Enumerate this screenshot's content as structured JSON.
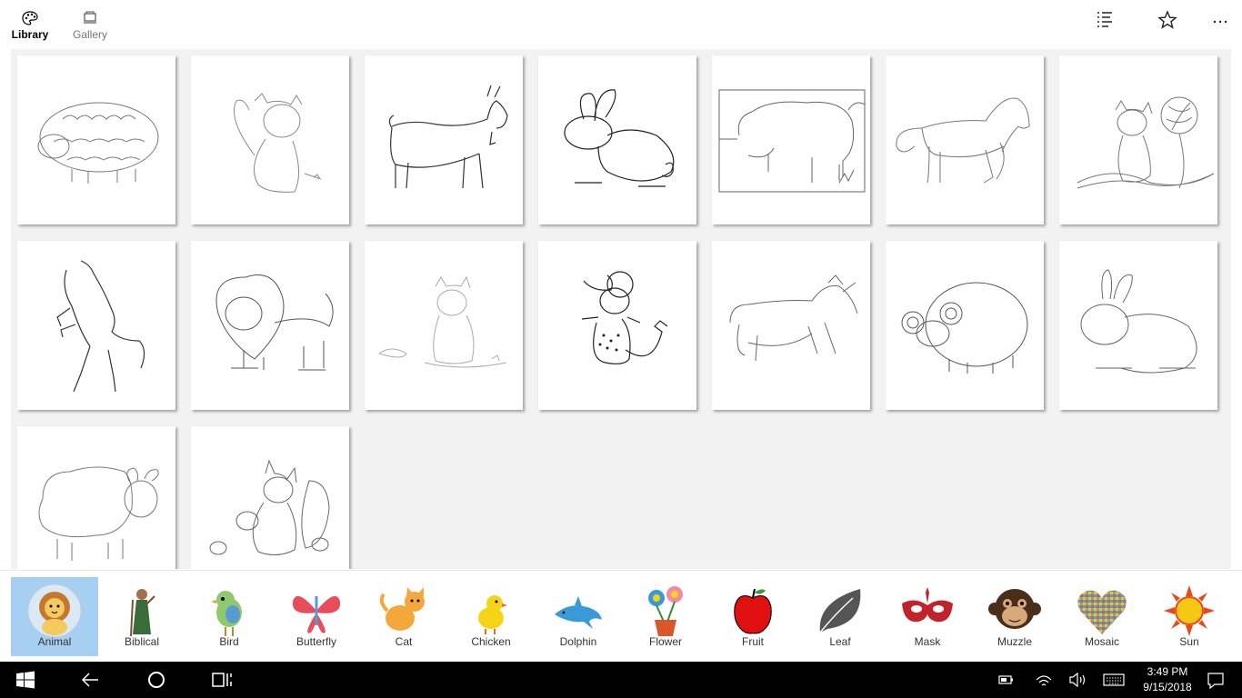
{
  "topbar": {
    "library_label": "Library",
    "gallery_label": "Gallery"
  },
  "categories": [
    {
      "label": "Animal"
    },
    {
      "label": "Biblical"
    },
    {
      "label": "Bird"
    },
    {
      "label": "Butterfly"
    },
    {
      "label": "Cat"
    },
    {
      "label": "Chicken"
    },
    {
      "label": "Dolphin"
    },
    {
      "label": "Flower"
    },
    {
      "label": "Fruit"
    },
    {
      "label": "Leaf"
    },
    {
      "label": "Mask"
    },
    {
      "label": "Muzzle"
    },
    {
      "label": "Mosaic"
    },
    {
      "label": "Sun"
    }
  ],
  "selected_category": "Animal",
  "tiles": [
    {
      "subject": "sheep"
    },
    {
      "subject": "cat-with-bone"
    },
    {
      "subject": "goat"
    },
    {
      "subject": "rabbit"
    },
    {
      "subject": "hippo"
    },
    {
      "subject": "horse"
    },
    {
      "subject": "cat-with-yarn"
    },
    {
      "subject": "rearing-horse"
    },
    {
      "subject": "lion"
    },
    {
      "subject": "cat-max"
    },
    {
      "subject": "mouse"
    },
    {
      "subject": "goat-running"
    },
    {
      "subject": "ram"
    },
    {
      "subject": "rabbit-sitting"
    },
    {
      "subject": "lamb"
    },
    {
      "subject": "squirrel"
    }
  ],
  "taskbar": {
    "time": "3:49 PM",
    "date": "9/15/2018"
  },
  "colors": {
    "selected_bg": "#a6cff2",
    "grid_bg": "#f2f2f2",
    "taskbar_bg": "#000000"
  }
}
